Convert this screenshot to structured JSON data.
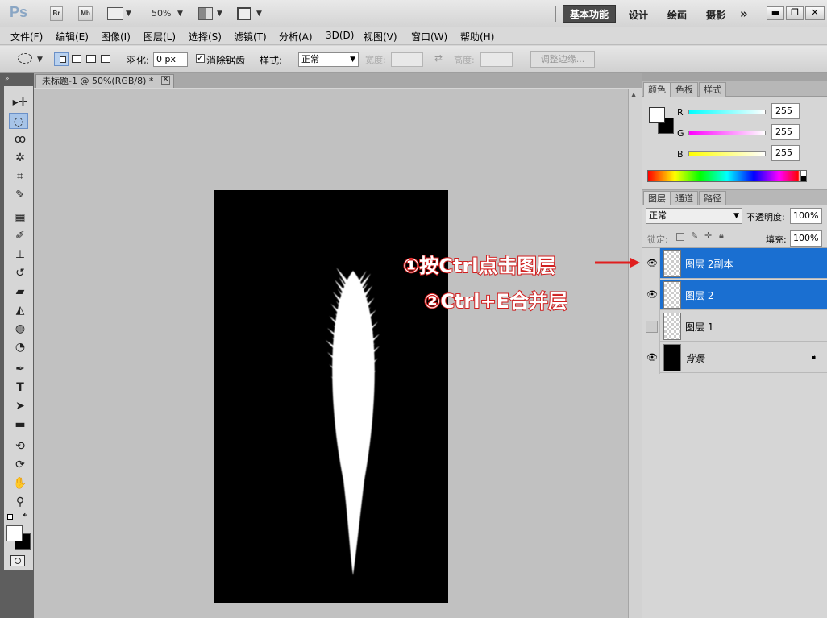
{
  "app": {
    "logo": "Ps",
    "bridge": "Br",
    "minibridge": "Mb",
    "zoom": "50%"
  },
  "workspaces": {
    "active": "基本功能",
    "items": [
      "设计",
      "绘画",
      "摄影"
    ],
    "more": "»"
  },
  "menu": [
    "文件(F)",
    "编辑(E)",
    "图像(I)",
    "图层(L)",
    "选择(S)",
    "滤镜(T)",
    "分析(A)",
    "3D(D)",
    "视图(V)",
    "窗口(W)",
    "帮助(H)"
  ],
  "options": {
    "feather_label": "羽化:",
    "feather_value": "0 px",
    "antialias_label": "消除锯齿",
    "style_label": "样式:",
    "style_value": "正常",
    "width_label": "宽度:",
    "height_label": "高度:",
    "refine_button": "调整边缘..."
  },
  "document": {
    "tab_title": "未标题-1 @ 50%(RGB/8) *"
  },
  "color_panel": {
    "tabs": [
      "颜色",
      "色板",
      "样式"
    ],
    "channels": [
      {
        "name": "R",
        "value": "255",
        "color": "#00ffff"
      },
      {
        "name": "G",
        "value": "255",
        "color": "#ff00ff"
      },
      {
        "name": "B",
        "value": "255",
        "color": "#ffff00"
      }
    ]
  },
  "layers_panel": {
    "tabs": [
      "图层",
      "通道",
      "路径"
    ],
    "blend_mode": "正常",
    "opacity_label": "不透明度:",
    "opacity_value": "100%",
    "lock_label": "锁定:",
    "fill_label": "填充:",
    "fill_value": "100%",
    "layers": [
      {
        "name": "图层 2副本",
        "selected": true,
        "visible": true
      },
      {
        "name": "图层 2",
        "selected": true,
        "visible": true
      },
      {
        "name": "图层 1",
        "selected": false,
        "visible": false
      },
      {
        "name": "背景",
        "selected": false,
        "visible": true,
        "locked": true
      }
    ]
  },
  "annotations": {
    "step1": "①按Ctrl点击图层",
    "step2": "②Ctrl+E合并层"
  }
}
